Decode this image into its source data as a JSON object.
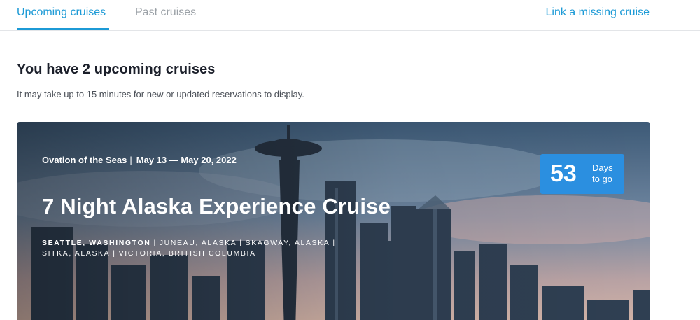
{
  "nav": {
    "tabs": [
      {
        "label": "Upcoming cruises",
        "active": true
      },
      {
        "label": "Past cruises",
        "active": false
      }
    ],
    "link_missing": "Link a missing cruise"
  },
  "main": {
    "heading": "You have 2 upcoming cruises",
    "subtext": "It may take up to 15 minutes for new or updated reservations to display."
  },
  "cruise": {
    "ship": "Ovation of the Seas",
    "dates": "May 13 — May 20, 2022",
    "title": "7 Night Alaska Experience Cruise",
    "ports": [
      {
        "name": "SEATTLE, WASHINGTON",
        "emphasis": true
      },
      {
        "name": "JUNEAU, ALASKA",
        "emphasis": false
      },
      {
        "name": "SKAGWAY, ALASKA",
        "emphasis": false
      },
      {
        "name": "SITKA, ALASKA",
        "emphasis": false
      },
      {
        "name": "VICTORIA, BRITISH COLUMBIA",
        "emphasis": false
      }
    ],
    "countdown": {
      "value": "53",
      "line1": "Days",
      "line2": "to go"
    }
  },
  "colors": {
    "accent": "#1c9ad6",
    "countdown_bg": "#2b8fe0"
  }
}
